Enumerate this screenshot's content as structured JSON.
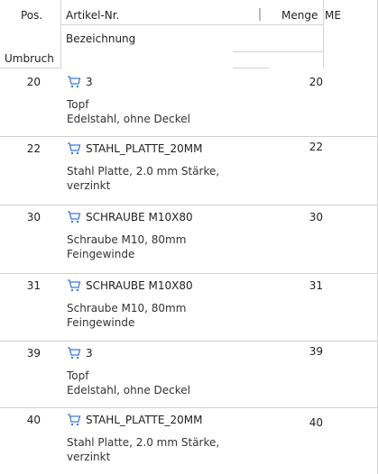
{
  "columns": {
    "pos": "Pos.",
    "artikel": "Artikel-Nr.",
    "menge": "Menge",
    "me": "ME",
    "bezeichnung": "Bezeichnung",
    "umbruch": "Umbruch"
  },
  "rows": [
    {
      "pos": "20",
      "artikel": "3",
      "menge": "20",
      "desc1": "Topf",
      "desc2": "Edelstahl, ohne Deckel",
      "icon": "cart-icon"
    },
    {
      "pos": "22",
      "artikel": "STAHL_PLATTE_20MM",
      "menge": "22",
      "desc1": "Stahl Platte, 2.0 mm Stärke,",
      "desc2": "verzinkt",
      "icon": "cart-icon"
    },
    {
      "pos": "30",
      "artikel": "SCHRAUBE M10X80",
      "menge": "30",
      "desc1": "Schraube M10, 80mm",
      "desc2": "Feingewinde",
      "icon": "cart-icon"
    },
    {
      "pos": "31",
      "artikel": "SCHRAUBE M10X80",
      "menge": "31",
      "desc1": "Schraube M10, 80mm",
      "desc2": "Feingewinde",
      "icon": "cart-icon"
    },
    {
      "pos": "39",
      "artikel": "3",
      "menge": "39",
      "desc1": "Topf",
      "desc2": "Edelstahl, ohne Deckel",
      "icon": "cart-icon"
    },
    {
      "pos": "40",
      "artikel": "STAHL_PLATTE_20MM",
      "menge": "40",
      "desc1": "Stahl Platte, 2.0 mm Stärke,",
      "desc2": "verzinkt",
      "icon": "cart-icon"
    }
  ],
  "colors": {
    "accent": "#3a7bd5",
    "grid": "#d0d0d0"
  }
}
